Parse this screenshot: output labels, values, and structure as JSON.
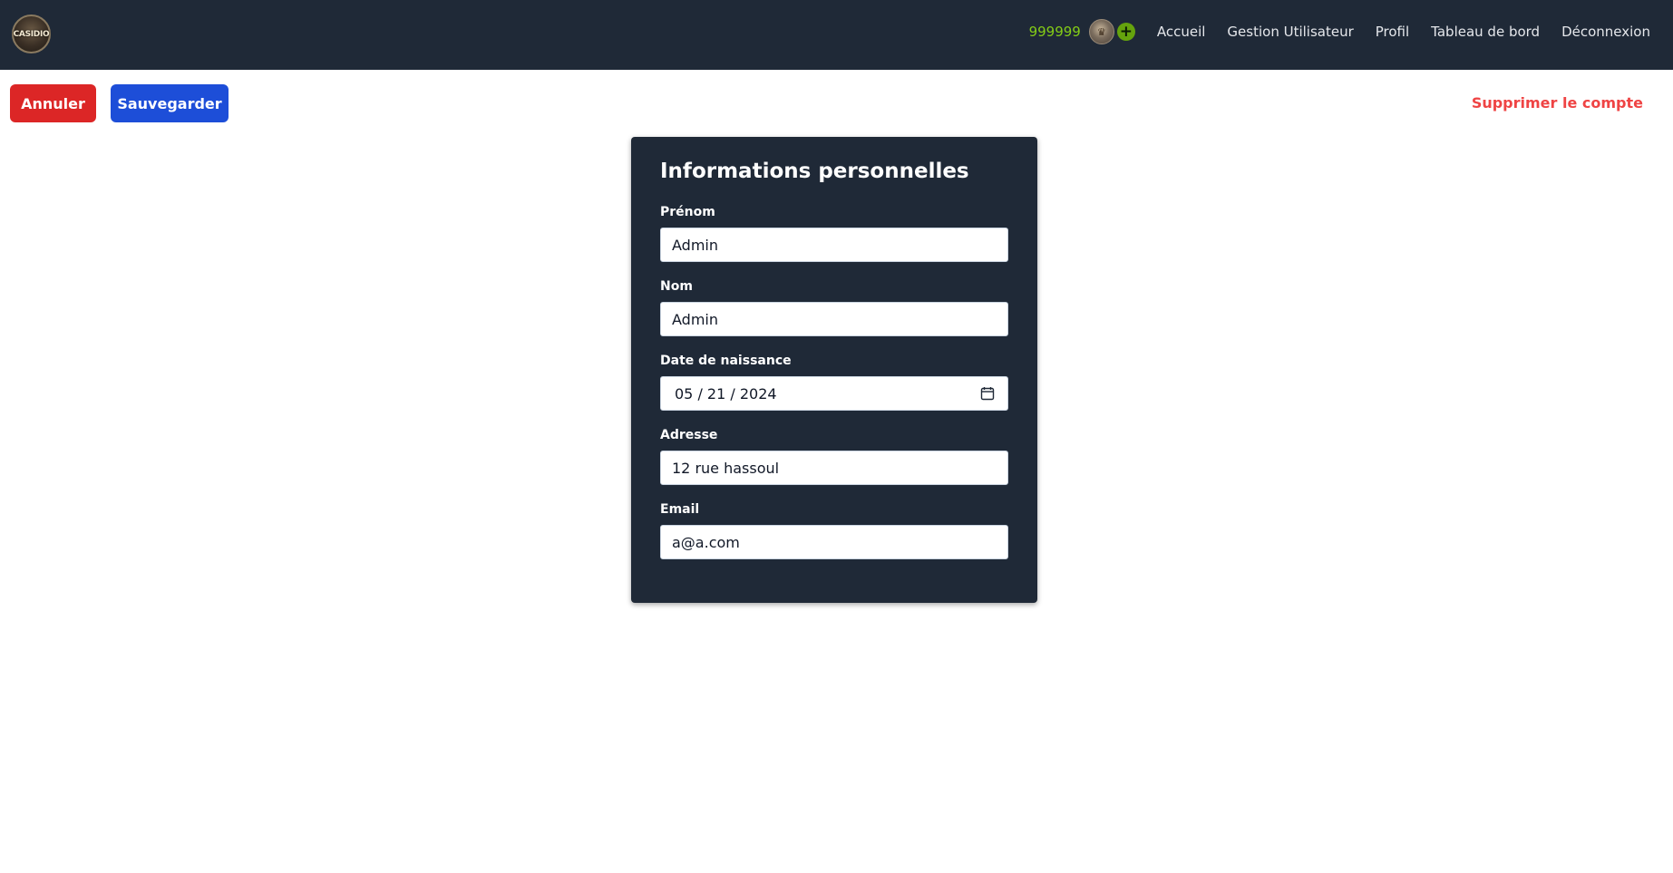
{
  "header": {
    "logo_text": "CASIDIO",
    "credits": "999999",
    "add_credits_label": "+",
    "nav": [
      "Accueil",
      "Gestion Utilisateur",
      "Profil",
      "Tableau de bord",
      "Déconnexion"
    ],
    "colors": {
      "background": "#1f2937",
      "credits": "#84cc16",
      "add_button": "#65a30d"
    }
  },
  "actions": {
    "cancel_label": "Annuler",
    "save_label": "Sauvegarder",
    "delete_label": "Supprimer le compte",
    "colors": {
      "cancel": "#dc2626",
      "save": "#1d4ed8",
      "delete": "#ef4444"
    }
  },
  "form": {
    "title": "Informations personnelles",
    "fields": [
      {
        "label": "Prénom",
        "value": "Admin"
      },
      {
        "label": "Nom",
        "value": "Admin"
      },
      {
        "label": "Date de naissance",
        "value": "05 / 21 / 2024",
        "icon": "calendar-icon"
      },
      {
        "label": "Adresse",
        "value": "12 rue hassoul"
      },
      {
        "label": "Email",
        "value": "a@a.com"
      }
    ]
  }
}
